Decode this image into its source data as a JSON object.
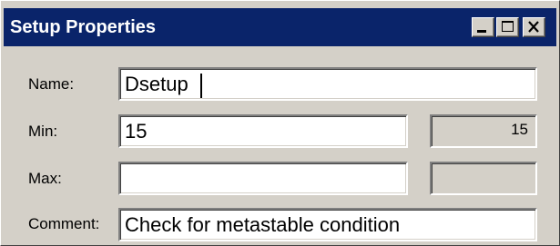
{
  "window": {
    "title": "Setup Properties",
    "controls": {
      "minimize_icon": "minimize-icon",
      "maximize_icon": "maximize-icon",
      "close_icon": "close-icon"
    },
    "titlebar_color": "#0a246a",
    "face_color": "#d4d0c8"
  },
  "form": {
    "name": {
      "label": "Name:",
      "value": "Dsetup"
    },
    "min": {
      "label": "Min:",
      "value": "15",
      "computed": "15"
    },
    "max": {
      "label": "Max:",
      "value": "",
      "computed": ""
    },
    "comment": {
      "label": "Comment:",
      "value": "Check for metastable condition"
    }
  }
}
